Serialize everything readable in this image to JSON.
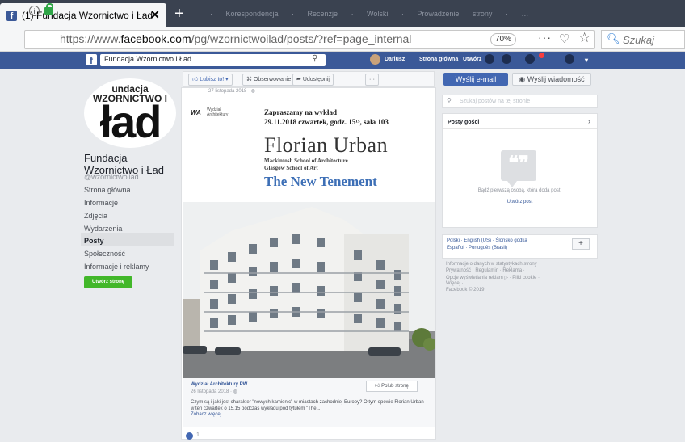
{
  "browser": {
    "tab_title": "(1) Fundacja Wzornictwo i Ład",
    "tab_close": "✕",
    "new_tab": "+",
    "dim_tabs": "· Korespondencja · Recenzje · Wolski · Prowadzenie strony · …",
    "url_prefix": "https://www.",
    "url_domain": "facebook.com",
    "url_rest": "/pg/wzornictwoilad/posts/?ref=page_internal",
    "zoom": "70%",
    "more": "···",
    "search_placeholder": "Szukaj"
  },
  "fbbar": {
    "search_value": "Fundacja Wzornictwo i Ład",
    "user": "Dariusz",
    "home": "Strona główna",
    "create": "Utwórz"
  },
  "page": {
    "logo_line1": "undacja",
    "logo_line2": "WZORNICTWO I",
    "logo_big": "ład",
    "name": "Fundacja Wzornictwo i Ład",
    "handle": "@wzornictwoilad",
    "nav": [
      "Strona główna",
      "Informacje",
      "Zdjęcia",
      "Wydarzenia",
      "Posty",
      "Społeczność",
      "Informacje i reklamy"
    ],
    "create_page": "Utwórz stronę"
  },
  "actions": {
    "like": "Lubisz to! ▾",
    "follow": "Obserwowanie ▾",
    "share": "Udostępnij",
    "more": "···",
    "email": "Wyślij e-mail",
    "message": "Wyślij wiadomość"
  },
  "post": {
    "date_top": "27 listopada 2018 · ",
    "wa_logo": "WA",
    "wa_text1": "Wydział",
    "wa_text2": "Architektury",
    "lecture1": "Zapraszamy na wykład",
    "lecture2": "29.11.2018 czwartek, godz. 15¹⁵, sala 103",
    "speaker": "Florian Urban",
    "sub1": "Mackintosh School of Architecture",
    "sub2": "Glasgow School of Art",
    "title": "The New Tenement",
    "cap_name": "Wydział Architektury PW",
    "cap_date": "26 listopada 2018 · ",
    "like_page": "Polub stronę",
    "cap_text": "Czym są i jaki jest charakter \"nowych kamienic\" w miastach zachodniej Europy? O tym opowie Florian Urban w ten czwartek o 15.15 podczas wykładu pod tytułem \"The...",
    "see_more": "Zobacz więcej",
    "reactions": "1"
  },
  "right": {
    "search_placeholder": "Szukaj postów na tej stronie",
    "guests_header": "Posty gości",
    "guests_first": "Bądź pierwszą osobą, która doda post.",
    "guests_add": "Utwórz post",
    "langs1": "Polski · English (US) · Ślōnskŏ gŏdka",
    "langs2": "Español · Português (Brasil)",
    "foot1": "Informacje o danych w statystykach strony",
    "foot2": "Prywatność · Regulamin · Reklama ·",
    "foot3": "Opcje wyświetlania reklam ▷ · Pliki cookie ·",
    "foot4": "Więcej ·",
    "foot5": "Facebook © 2019"
  },
  "colors": {
    "fb_blue": "#3b5998",
    "button_blue": "#4267b2",
    "green": "#42b72a",
    "title_blue": "#3d6fb6"
  }
}
